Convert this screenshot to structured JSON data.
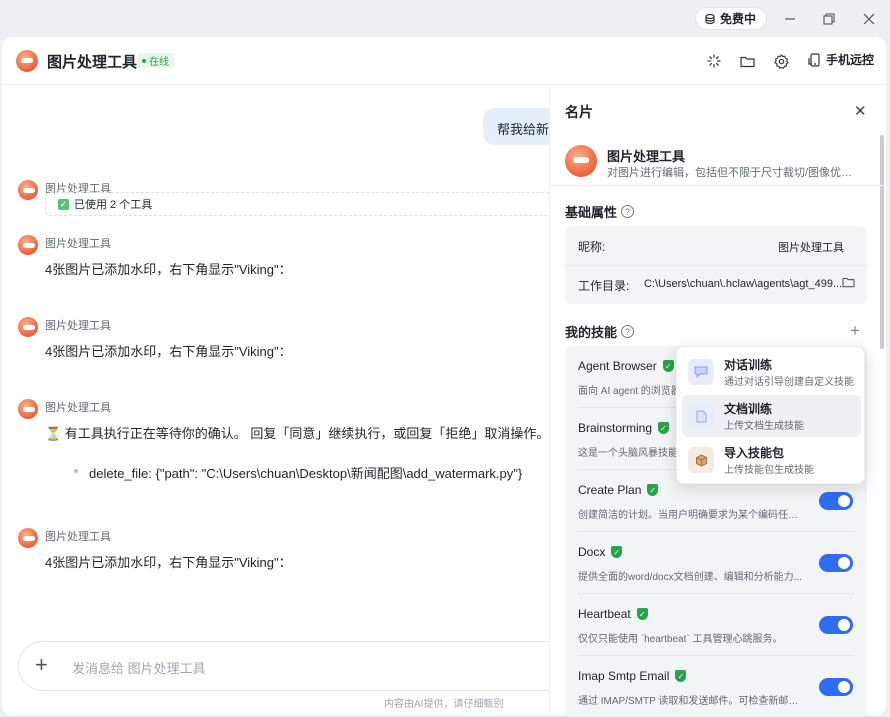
{
  "titlebar": {
    "plan_label": "免费中"
  },
  "header": {
    "title": "图片处理工具",
    "status": "在线",
    "remote_label": "手机远控"
  },
  "chat": {
    "user_message": "帮我给新闻",
    "messages": [
      {
        "sender": "图片处理工具",
        "tools_used": "已使用 2 个工具"
      },
      {
        "sender": "图片处理工具",
        "text": "4张图片已添加水印，右下角显示\"Viking\"："
      },
      {
        "sender": "图片处理工具",
        "text": "4张图片已添加水印，右下角显示\"Viking\"："
      },
      {
        "sender": "图片处理工具",
        "text": "⏳ 有工具执行正在等待你的确认。 回复「同意」继续执行，或回复「拒绝」取消操作。",
        "bullet": "delete_file: {\"path\": \"C:\\Users\\chuan\\Desktop\\新闻配图\\add_watermark.py\"}"
      },
      {
        "sender": "图片处理工具",
        "text": "4张图片已添加水印，右下角显示\"Viking\"："
      }
    ],
    "composer_placeholder": "发消息给 图片处理工具",
    "disclaimer": "内容由AI提供，请仔细甄别"
  },
  "panel": {
    "title": "名片",
    "profile_name": "图片处理工具",
    "profile_desc": "对图片进行编辑，包括但不限于尺寸裁切/图像优化等功...",
    "basic_title": "基础属性",
    "nickname_label": "昵称:",
    "nickname_value": "图片处理工具",
    "workdir_label": "工作目录:",
    "workdir_value": "C:\\Users\\chuan\\.hclaw\\agents\\agt_499...",
    "skills_title": "我的技能",
    "skills": [
      {
        "name": "Agent Browser",
        "desc": "面向 AI agent 的浏览器",
        "enabled": true
      },
      {
        "name": "Brainstorming",
        "desc": "这是一个头脑风暴技能",
        "enabled": true
      },
      {
        "name": "Create Plan",
        "desc": "创建简洁的计划。当用户明确要求为某个编码任务...",
        "enabled": true
      },
      {
        "name": "Docx",
        "desc": "提供全面的word/docx文档创建、编辑和分析能力...",
        "enabled": true
      },
      {
        "name": "Heartbeat",
        "desc": "仅仅只能使用 `heartbeat` 工具管理心跳服务。",
        "enabled": true
      },
      {
        "name": "Imap Smtp Email",
        "desc": "通过 IMAP/SMTP 读取和发送邮件。可检查新邮件...",
        "enabled": true
      }
    ]
  },
  "dropdown": {
    "items": [
      {
        "label": "对话训练",
        "sub": "通过对话引导创建自定义技能",
        "icon": "chat-icon"
      },
      {
        "label": "文档训练",
        "sub": "上传文档生成技能",
        "icon": "document-icon"
      },
      {
        "label": "导入技能包",
        "sub": "上传技能包生成技能",
        "icon": "package-icon"
      }
    ]
  },
  "colors": {
    "accent": "#2f6cf0",
    "online": "#2aa14a",
    "user_bubble": "#e6eefc"
  }
}
